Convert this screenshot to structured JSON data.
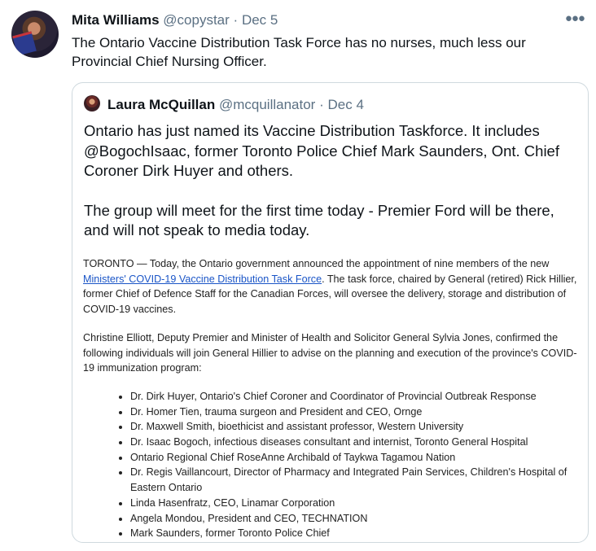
{
  "tweet": {
    "author": "Mita Williams",
    "handle": "@copystar",
    "date": "Dec 5",
    "text": "The Ontario Vaccine Distribution Task Force has no nurses, much less our Provincial Chief Nursing Officer.",
    "more_icon": "more-horizontal-icon"
  },
  "quoted": {
    "author": "Laura McQuillan",
    "handle": "@mcquillanator",
    "date": "Dec 4",
    "para1": "Ontario has just named its Vaccine Distribution Taskforce. It includes @BogochIsaac, former Toronto Police Chief Mark Saunders, Ont. Chief Coroner Dirk Huyer and others.",
    "para2": "The group will meet for the first time today - Premier Ford will be there, and will not speak to media today.",
    "press": {
      "p1_before": "TORONTO — Today, the Ontario government announced the appointment of nine members of the new ",
      "p1_link": "Ministers' COVID-19 Vaccine Distribution Task Force",
      "p1_after": ". The task force, chaired by General (retired) Rick Hillier, former Chief of Defence Staff for the Canadian Forces, will oversee the delivery, storage and distribution of COVID-19 vaccines.",
      "p2": "Christine Elliott, Deputy Premier and Minister of Health and Solicitor General Sylvia Jones, confirmed the following individuals will join General Hillier to advise on the planning and execution of the province's COVID-19 immunization program:",
      "members": [
        "Dr. Dirk Huyer, Ontario's Chief Coroner and Coordinator of Provincial Outbreak Response",
        "Dr. Homer Tien, trauma surgeon and President and CEO, Ornge",
        "Dr. Maxwell Smith, bioethicist and assistant professor, Western University",
        "Dr. Isaac Bogoch, infectious diseases consultant and internist, Toronto General Hospital",
        "Ontario Regional Chief RoseAnne Archibald of Taykwa Tagamou Nation",
        "Dr. Regis Vaillancourt, Director of Pharmacy and Integrated Pain Services, Children's Hospital of Eastern Ontario",
        "Linda Hasenfratz, CEO, Linamar Corporation",
        "Angela Mondou, President and CEO, TECHNATION",
        "Mark Saunders, former Toronto Police Chief"
      ]
    }
  }
}
